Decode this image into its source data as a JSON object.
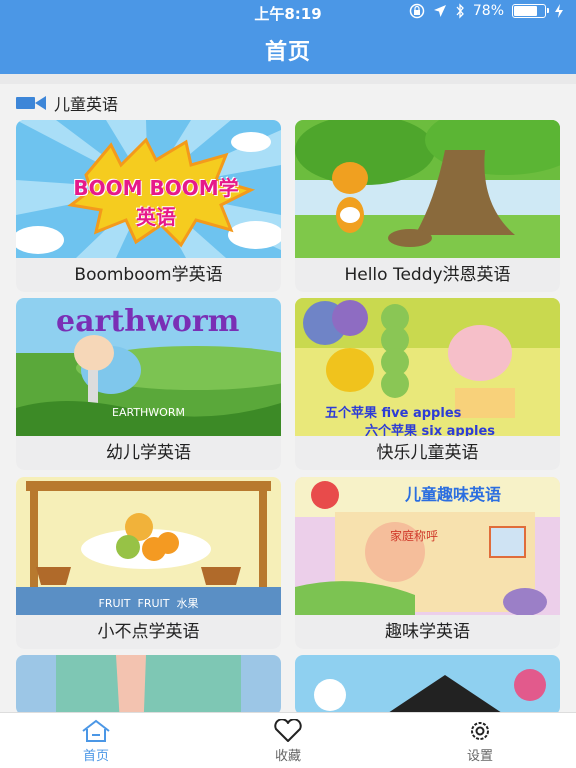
{
  "status_bar": {
    "time": "上午8:19",
    "battery_percent": "78%",
    "battery_level": 0.78,
    "icons": [
      "orientation-lock-icon",
      "location-icon",
      "bluetooth-icon",
      "battery-icon",
      "charging-icon"
    ]
  },
  "nav": {
    "title": "首页"
  },
  "section": {
    "title": "儿童英语",
    "icon": "video-camera-icon"
  },
  "cards": [
    {
      "title": "Boomboom学英语",
      "thumb_text": "BOOM BOOM学英语"
    },
    {
      "title": "Hello Teddy洪恩英语"
    },
    {
      "title": "幼儿学英语",
      "thumb_text": "earthworm",
      "thumb_caption": "EARTHWORM"
    },
    {
      "title": "快乐儿童英语",
      "thumb_line1": "五个苹果 five apples",
      "thumb_line2": "六个苹果 six apples"
    },
    {
      "title": "小不点学英语",
      "thumb_caption": "FRUIT  FRUIT  水果"
    },
    {
      "title": "趣味学英语",
      "thumb_text": "儿童趣味英语",
      "thumb_sign": "家庭称呼"
    },
    {
      "title": ""
    },
    {
      "title": ""
    }
  ],
  "tabbar": {
    "items": [
      {
        "label": "首页",
        "icon": "home-icon",
        "active": true
      },
      {
        "label": "收藏",
        "icon": "heart-icon",
        "active": false
      },
      {
        "label": "设置",
        "icon": "gear-icon",
        "active": false
      }
    ]
  },
  "colors": {
    "accent": "#4b97e6",
    "tab_inactive": "#666666",
    "label_bg": "#ededee"
  }
}
